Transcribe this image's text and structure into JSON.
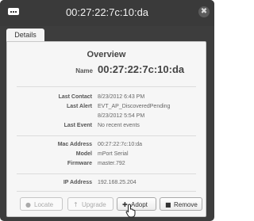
{
  "window": {
    "title": "00:27:22:7c:10:da",
    "app_icon": "device-icon",
    "close_icon": "close-icon",
    "close_glyph": "✖"
  },
  "tabs": [
    {
      "label": "Details",
      "active": true
    }
  ],
  "overview": {
    "section_title": "Overview",
    "name_label": "Name",
    "name_value": "00:27:22:7c:10:da"
  },
  "details": [
    {
      "label": "Last Contact",
      "value": "8/23/2012 6:43 PM"
    },
    {
      "label": "Last Alert",
      "value": "EVT_AP_DiscoveredPending"
    },
    {
      "label": "",
      "value": "8/23/2012 5:54 PM"
    },
    {
      "label": "Last Event",
      "value": "No recent events"
    },
    {
      "label": "Mac Address",
      "value": "00:27:22:7c:10:da"
    },
    {
      "label": "Model",
      "value": "mPort Serial"
    },
    {
      "label": "Firmware",
      "value": "master.792"
    },
    {
      "label": "IP Address",
      "value": "192.168.25.204"
    }
  ],
  "buttons": [
    {
      "label": "Locate",
      "icon": "location-pin-icon",
      "glyph": "●",
      "enabled": false
    },
    {
      "label": "Upgrade",
      "icon": "upgrade-icon",
      "glyph": "↑",
      "enabled": false
    },
    {
      "label": "Adopt",
      "icon": "plus-icon",
      "glyph": "✚",
      "enabled": true
    },
    {
      "label": "Remove",
      "icon": "trash-icon",
      "glyph": "■",
      "enabled": true
    }
  ],
  "colors": {
    "window_bg": "#3d3d3d",
    "panel_bg": "#f6f6f6",
    "title_text": "#f2f2f2",
    "disabled_text": "#aaaaaa"
  }
}
